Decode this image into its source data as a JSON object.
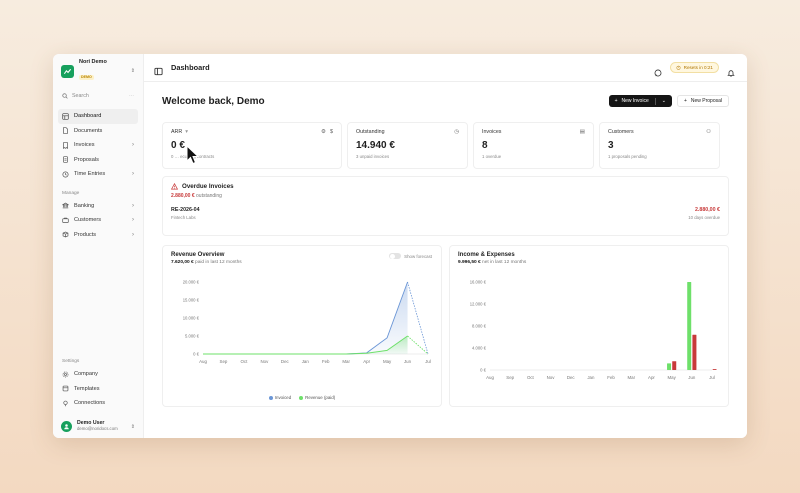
{
  "sidebar": {
    "org_name": "Nori Demo",
    "org_badge": "DEMO",
    "search_placeholder": "Search",
    "search_shortcut": "⋯",
    "items": [
      {
        "label": "Dashboard",
        "icon": "dashboard-icon",
        "active": true
      },
      {
        "label": "Documents",
        "icon": "document-icon"
      },
      {
        "label": "Invoices",
        "icon": "invoice-icon",
        "expandable": true
      },
      {
        "label": "Proposals",
        "icon": "proposal-icon"
      },
      {
        "label": "Time Entries",
        "icon": "clock-icon",
        "expandable": true
      }
    ],
    "manage_label": "Manage",
    "manage_items": [
      {
        "label": "Banking",
        "icon": "bank-icon",
        "expandable": true
      },
      {
        "label": "Customers",
        "icon": "customers-icon",
        "expandable": true
      },
      {
        "label": "Products",
        "icon": "box-icon",
        "expandable": true
      }
    ],
    "settings_label": "Settings",
    "settings_items": [
      {
        "label": "Company",
        "icon": "gear-icon"
      },
      {
        "label": "Templates",
        "icon": "template-icon"
      },
      {
        "label": "Connections",
        "icon": "link-icon"
      }
    ],
    "user_name": "Demo User",
    "user_email": "demo@noridocs.com"
  },
  "topbar": {
    "title": "Dashboard",
    "reset_label": "Resets in 0:21"
  },
  "header": {
    "welcome": "Welcome back, Demo",
    "new_invoice": "New Invoice",
    "new_proposal": "New Proposal"
  },
  "stats": [
    {
      "label": "ARR",
      "value": "0 €",
      "sub": "0 … ecurring contracts"
    },
    {
      "label": "Outstanding",
      "value": "14.940 €",
      "sub": "3 unpaid invoices"
    },
    {
      "label": "Invoices",
      "value": "8",
      "sub": "1 overdue"
    },
    {
      "label": "Customers",
      "value": "3",
      "sub": "1 proposals pending"
    }
  ],
  "overdue": {
    "title": "Overdue Invoices",
    "amount": "2.880,00 €",
    "amount_suffix": "outstanding",
    "invoice_number": "RE-2026-04",
    "customer": "Fintech Labs",
    "invoice_amount": "2.880,00 €",
    "days_overdue": "10 days overdue"
  },
  "revenue": {
    "title": "Revenue Overview",
    "sub_value": "7.620,00 €",
    "sub_text": "paid in last 12 months",
    "forecast_label": "Show forecast",
    "legend_invoiced": "Invoiced",
    "legend_paid": "Revenue (paid)"
  },
  "income": {
    "title": "Income & Expenses",
    "sub_value": "9.996,50 €",
    "sub_text": "net in last 12 months"
  },
  "colors": {
    "brand": "#17a05d",
    "invoiced": "#6b96d6",
    "paid": "#6ee06a",
    "expense": "#c83a3a",
    "dark_button": "#151515"
  },
  "chart_data": [
    {
      "type": "area",
      "title": "Revenue Overview",
      "categories": [
        "Aug",
        "Sep",
        "Oct",
        "Nov",
        "Dec",
        "Jan",
        "Feb",
        "Mar",
        "Apr",
        "May",
        "Jun",
        "Jul"
      ],
      "yticks": [
        "20.000 €",
        "15.000 €",
        "10.000 €",
        "5.000 €",
        "0 €"
      ],
      "ylim": [
        0,
        20000
      ],
      "series": [
        {
          "name": "Invoiced",
          "values": [
            0,
            0,
            0,
            0,
            0,
            0,
            0,
            0,
            300,
            4500,
            20000,
            0
          ]
        },
        {
          "name": "Revenue (paid)",
          "values": [
            0,
            0,
            0,
            0,
            0,
            0,
            0,
            0,
            200,
            1000,
            5000,
            0
          ]
        }
      ],
      "forecast_dashed": true
    },
    {
      "type": "bar",
      "title": "Income & Expenses",
      "categories": [
        "Aug",
        "Sep",
        "Oct",
        "Nov",
        "Dec",
        "Jan",
        "Feb",
        "Mar",
        "Apr",
        "May",
        "Jun",
        "Jul"
      ],
      "yticks": [
        "16.000 €",
        "12.000 €",
        "8.000 €",
        "4.000 €",
        "0 €"
      ],
      "ylim": [
        0,
        16000
      ],
      "series": [
        {
          "name": "Income",
          "values": [
            0,
            0,
            0,
            0,
            0,
            0,
            0,
            0,
            0,
            1200,
            16000,
            0
          ]
        },
        {
          "name": "Expenses",
          "values": [
            0,
            0,
            0,
            0,
            0,
            0,
            0,
            0,
            0,
            1600,
            6400,
            150
          ]
        }
      ]
    }
  ]
}
